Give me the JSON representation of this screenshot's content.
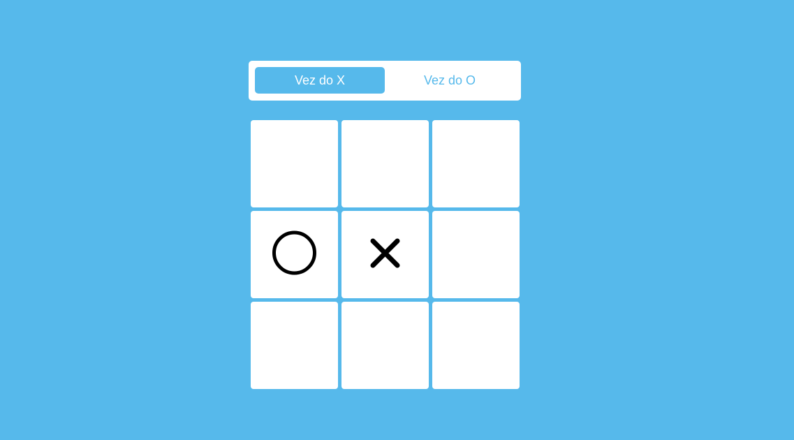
{
  "turn": {
    "x_label": "Vez do X",
    "o_label": "Vez do O",
    "active": "X"
  },
  "board": {
    "cells": [
      "",
      "",
      "",
      "O",
      "X",
      "",
      "",
      "",
      ""
    ]
  },
  "colors": {
    "background": "#56b9eb",
    "cell": "#ffffff",
    "mark": "#000000"
  }
}
